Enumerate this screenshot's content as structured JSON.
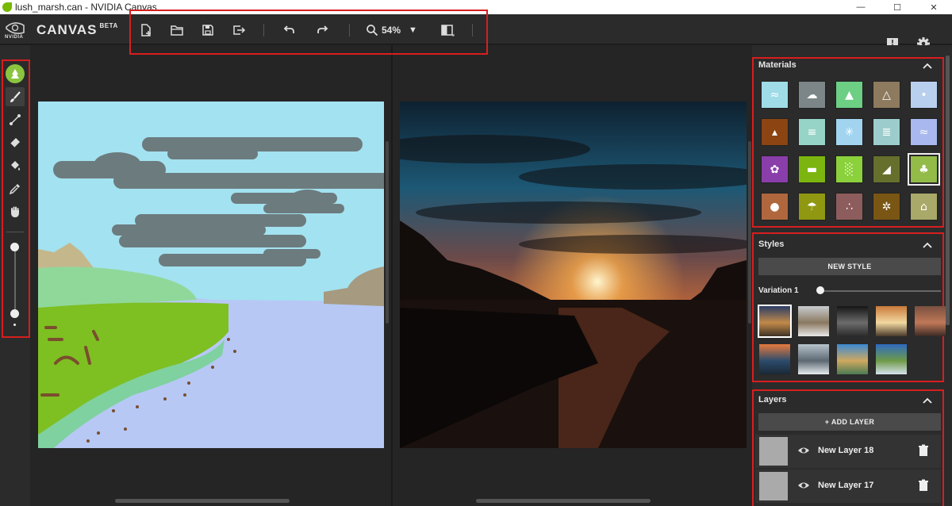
{
  "window": {
    "title": "lush_marsh.can - NVIDIA Canvas",
    "minimize": "—",
    "maximize": "☐",
    "close": "✕"
  },
  "header": {
    "nvidia_logo_text": "NVIDIA",
    "brand": "CANVAS",
    "brand_tag": "BETA",
    "zoom_value": "54%"
  },
  "toolbar": [
    {
      "name": "new-file-icon"
    },
    {
      "name": "open-folder-icon"
    },
    {
      "name": "save-icon"
    },
    {
      "name": "export-icon"
    },
    {
      "name": "undo-icon"
    },
    {
      "name": "redo-icon"
    },
    {
      "name": "zoom-icon"
    },
    {
      "name": "split-view-icon"
    }
  ],
  "tools": [
    "material-tree-icon",
    "brush-icon",
    "line-icon",
    "eraser-icon",
    "fill-bucket-icon",
    "eyedropper-icon",
    "pan-hand-icon"
  ],
  "brush_size": 1.0,
  "materials": {
    "title": "Materials",
    "items": [
      {
        "name": "sea",
        "color": "#9fdce8"
      },
      {
        "name": "cloud",
        "color": "#7c8688"
      },
      {
        "name": "grass-hill",
        "color": "#6ccf84"
      },
      {
        "name": "mountain",
        "color": "#8e7a5e"
      },
      {
        "name": "water-drop",
        "color": "#b9cfee"
      },
      {
        "name": "dirt",
        "color": "#8c4412"
      },
      {
        "name": "fog",
        "color": "#96d4c7"
      },
      {
        "name": "snow",
        "color": "#a2d4f0"
      },
      {
        "name": "mist",
        "color": "#9ccdcc"
      },
      {
        "name": "water",
        "color": "#a9b8ee"
      },
      {
        "name": "flower",
        "color": "#8a3eaa"
      },
      {
        "name": "grass",
        "color": "#7cb50f"
      },
      {
        "name": "tall-grass",
        "color": "#8bd13b"
      },
      {
        "name": "rock",
        "color": "#66702c"
      },
      {
        "name": "tree",
        "color": "#93bb48"
      },
      {
        "name": "stone",
        "color": "#b0673e"
      },
      {
        "name": "palm",
        "color": "#909812"
      },
      {
        "name": "gravel",
        "color": "#8c5d5c"
      },
      {
        "name": "sand",
        "color": "#7a5614"
      },
      {
        "name": "bridge",
        "color": "#a9a969"
      }
    ]
  },
  "styles": {
    "title": "Styles",
    "new_style_label": "NEW STYLE",
    "variation_label": "Variation 1",
    "variation_value": 0.0,
    "thumbs": [
      {
        "name": "style-1",
        "colors": [
          "#2b3d66",
          "#c28a4a",
          "#3c3224"
        ]
      },
      {
        "name": "style-2",
        "colors": [
          "#c8ccd0",
          "#8a7860",
          "#e8e8e8"
        ]
      },
      {
        "name": "style-3",
        "colors": [
          "#151515",
          "#6c6c6c",
          "#2a2a2a"
        ]
      },
      {
        "name": "style-4",
        "colors": [
          "#c97a3a",
          "#f2d8a0",
          "#4a3a2a"
        ]
      },
      {
        "name": "style-5",
        "colors": [
          "#7a5040",
          "#c07858",
          "#3a2a24"
        ]
      },
      {
        "name": "style-6",
        "colors": [
          "#e8793c",
          "#2c4c6c",
          "#1a2836"
        ]
      },
      {
        "name": "style-7",
        "colors": [
          "#b8c4cc",
          "#5c6872",
          "#e6ecee"
        ]
      },
      {
        "name": "style-8",
        "colors": [
          "#3b8ad2",
          "#cfa860",
          "#4a7a52"
        ]
      },
      {
        "name": "style-9",
        "colors": [
          "#2e6bc0",
          "#6e9a48",
          "#d6e2ee"
        ]
      }
    ]
  },
  "layers": {
    "title": "Layers",
    "add_label": "+ ADD LAYER",
    "items": [
      {
        "name": "New Layer 18"
      },
      {
        "name": "New Layer 17"
      }
    ]
  }
}
